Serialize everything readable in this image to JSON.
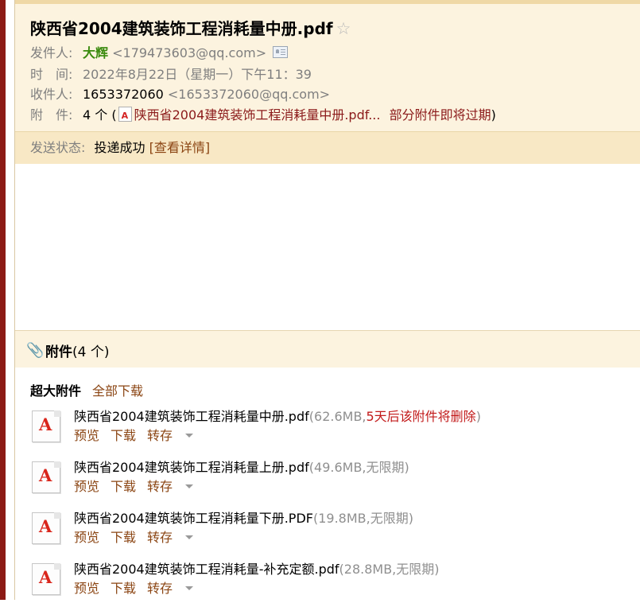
{
  "email": {
    "subject": "陕西省2004建筑装饰工程消耗量中册.pdf",
    "star_icon": "star-outline-icon",
    "from_label": "发件人:",
    "from_name": "大辉",
    "from_email": "<179473603@qq.com>",
    "time_label": "时　间:",
    "time_value": "2022年8月22日（星期一）下午11：39",
    "to_label": "收件人:",
    "to_name": "1653372060",
    "to_email": "<1653372060@qq.com>",
    "att_label": "附　件:",
    "att_count": "4 个",
    "att_paren_open": "(",
    "att_first_file": "陕西省2004建筑装饰工程消耗量中册.pdf...",
    "att_expire_note": "部分附件即将过期",
    "att_paren_close": ")"
  },
  "status": {
    "label": "发送状态:",
    "value": "投递成功",
    "details_link": "[查看详情]"
  },
  "attachments": {
    "title": "附件",
    "count": "(4 个)",
    "big_label": "超大附件",
    "download_all": "全部下载",
    "actions": {
      "preview": "预览",
      "download": "下载",
      "save": "转存"
    },
    "files": [
      {
        "name": "陕西省2004建筑装饰工程消耗量中册.pdf",
        "meta_open": "(62.6MB,",
        "warn": "5天后该附件将删除",
        "meta_close": ")"
      },
      {
        "name": "陕西省2004建筑装饰工程消耗量上册.pdf",
        "meta": "(49.6MB,无限期)"
      },
      {
        "name": "陕西省2004建筑装饰工程消耗量下册.PDF",
        "meta": "(19.8MB,无限期)"
      },
      {
        "name": "陕西省2004建筑装饰工程消耗量-补充定额.pdf",
        "meta": "(28.8MB,无限期)"
      }
    ]
  },
  "colors": {
    "header_bg": "#fcf3df",
    "status_bg": "#f8e8c5",
    "sender_green": "#3a8a0d",
    "warn_red": "#c21a1a",
    "link_brown": "#8b4513",
    "left_bar": "#8c1a15"
  }
}
